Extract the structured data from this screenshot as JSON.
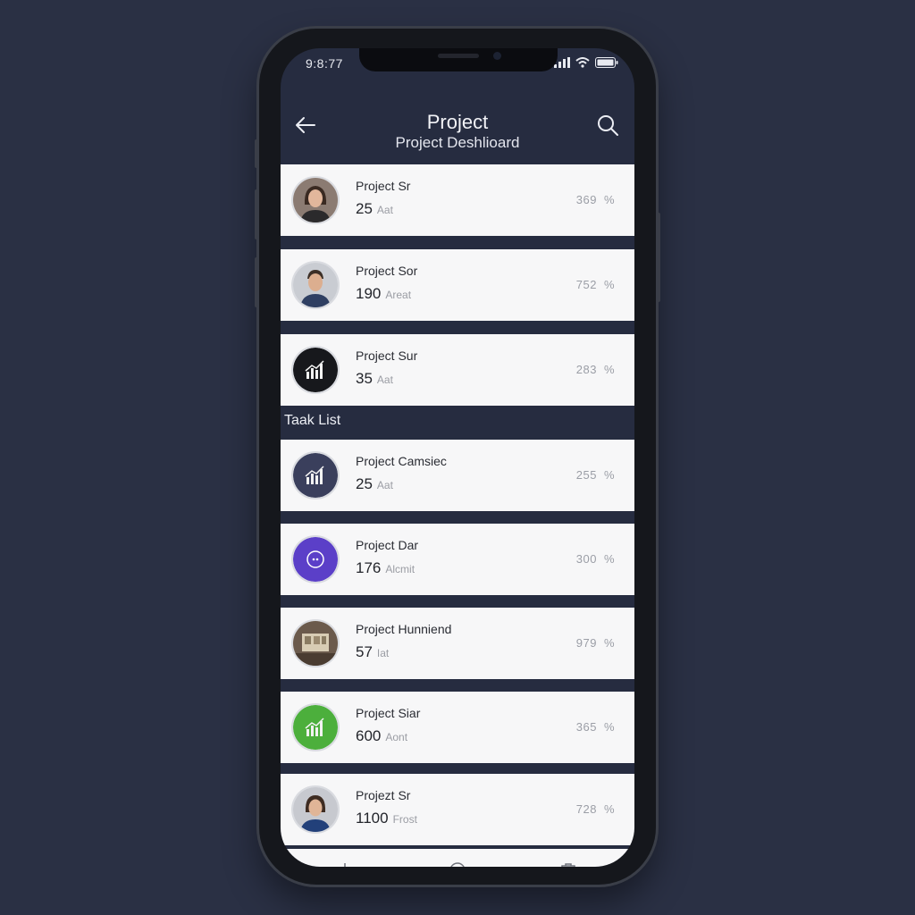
{
  "status_bar": {
    "time": "9:8:77"
  },
  "header": {
    "title": "Project",
    "subtitle": "Project Deshlioard"
  },
  "section": {
    "task_list_label": "Taak List"
  },
  "projects": [
    {
      "name": "Project Sr",
      "count": "25",
      "unit": "Aat",
      "percent": "369",
      "pct_sign": "%",
      "avatar": "photo-woman"
    },
    {
      "name": "Project Sor",
      "count": "190",
      "unit": "Areat",
      "percent": "752",
      "pct_sign": "%",
      "avatar": "photo-man"
    },
    {
      "name": "Project Sur",
      "count": "35",
      "unit": "Aat",
      "percent": "283",
      "pct_sign": "%",
      "avatar": "chart-black"
    }
  ],
  "tasks": [
    {
      "name": "Project Camsiec",
      "count": "25",
      "unit": "Aat",
      "percent": "255",
      "pct_sign": "%",
      "avatar": "chart-navy"
    },
    {
      "name": "Project Dar",
      "count": "176",
      "unit": "Alcmit",
      "percent": "300",
      "pct_sign": "%",
      "avatar": "purple-badge"
    },
    {
      "name": "Project Hunniend",
      "count": "57",
      "unit": "Iat",
      "percent": "979",
      "pct_sign": "%",
      "avatar": "photo-room"
    },
    {
      "name": "Project Siar",
      "count": "600",
      "unit": "Aont",
      "percent": "365",
      "pct_sign": "%",
      "avatar": "chart-green"
    },
    {
      "name": "Projezt Sr",
      "count": "1100",
      "unit": "Frost",
      "percent": "728",
      "pct_sign": "%",
      "avatar": "photo-woman-2"
    }
  ],
  "colors": {
    "background": "#2a3044",
    "screen": "#262c40",
    "card": "#f7f7f8",
    "accent_purple": "#5b3fc8",
    "accent_green": "#4caf3c",
    "navy": "#3a3f5c"
  },
  "tab_bar": {
    "icons": [
      "share-icon",
      "home-circle-icon",
      "clipboard-icon"
    ]
  }
}
